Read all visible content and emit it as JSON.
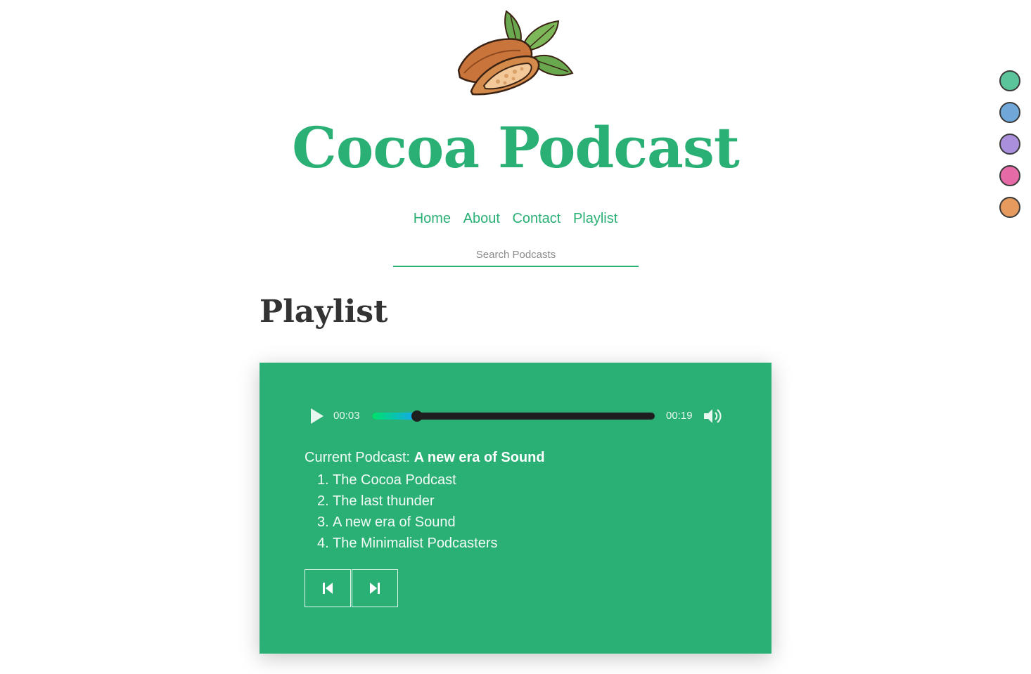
{
  "site": {
    "title": "Cocoa Podcast",
    "logo_icon": "cocoa-pod-logo"
  },
  "nav": {
    "items": [
      "Home",
      "About",
      "Contact",
      "Playlist"
    ]
  },
  "search": {
    "placeholder": "Search Podcasts",
    "value": ""
  },
  "section": {
    "title": "Playlist"
  },
  "player": {
    "current_time": "00:03",
    "duration": "00:19",
    "progress_fraction": 0.16,
    "play_icon": "play-icon",
    "volume_icon": "volume-icon",
    "current_label": "Current Podcast:",
    "current_title": "A new era of Sound",
    "tracks": [
      {
        "number": "1.",
        "title": "The Cocoa Podcast"
      },
      {
        "number": "2.",
        "title": "The last thunder"
      },
      {
        "number": "3.",
        "title": "A new era of Sound"
      },
      {
        "number": "4.",
        "title": "The Minimalist Podcasters"
      }
    ],
    "prev_icon": "skip-previous-icon",
    "next_icon": "skip-next-icon"
  },
  "theme_swatches": [
    {
      "name": "green",
      "color": "#5cc49a"
    },
    {
      "name": "blue",
      "color": "#6fa8d8"
    },
    {
      "name": "purple",
      "color": "#a98fdc"
    },
    {
      "name": "pink",
      "color": "#e56aa6"
    },
    {
      "name": "orange",
      "color": "#e69a5e"
    }
  ],
  "colors": {
    "accent": "#2ab075",
    "heading": "#333333"
  }
}
